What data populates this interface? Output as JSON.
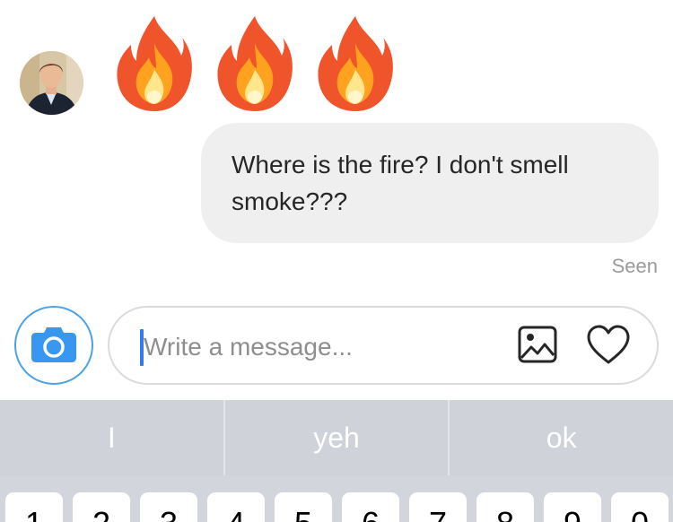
{
  "thread": {
    "reactions": [
      {
        "icon": "fire-emoji"
      },
      {
        "icon": "fire-emoji"
      },
      {
        "icon": "fire-emoji"
      }
    ],
    "sent_message": "Where is the fire? I don't smell smoke???",
    "status": "Seen"
  },
  "composer": {
    "placeholder": "Write a message...",
    "value": "",
    "camera_icon": "camera-icon",
    "gallery_icon": "image-gallery-icon",
    "like_icon": "heart-icon"
  },
  "suggestions": [
    "I",
    "yeh",
    "ok"
  ],
  "keyboard": {
    "keys": [
      "1",
      "2",
      "3",
      "4",
      "5",
      "6",
      "7",
      "8",
      "9",
      "0"
    ]
  },
  "colors": {
    "accent": "#3897f0",
    "bubble": "#efefef",
    "suggestion_bar": "#cfd3d9",
    "keyboard_bg": "#d2d5db"
  }
}
